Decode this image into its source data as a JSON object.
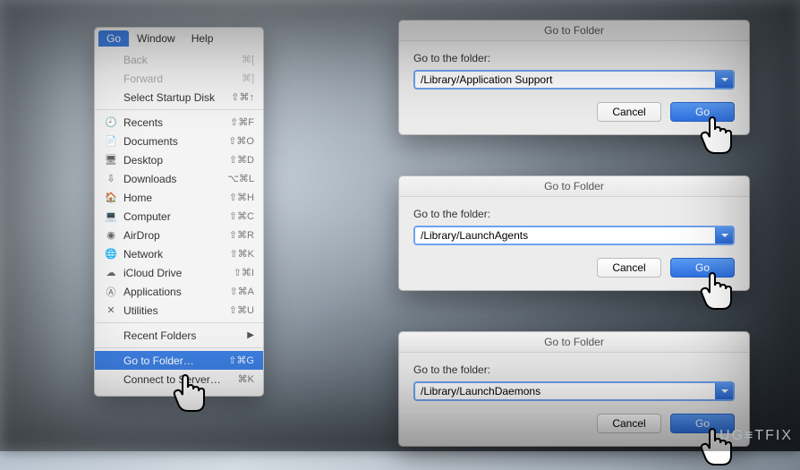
{
  "watermark": "UG≡TFIX",
  "menu": {
    "tabs": [
      "Go",
      "Window",
      "Help"
    ],
    "active_tab": "Go",
    "items_block1": [
      {
        "label": "Back",
        "shortcut": "⌘[",
        "disabled": true
      },
      {
        "label": "Forward",
        "shortcut": "⌘]",
        "disabled": true
      },
      {
        "label": "Select Startup Disk",
        "shortcut": "⇧⌘↑",
        "disabled": false
      }
    ],
    "items_block2": [
      {
        "icon": "recents-icon",
        "glyph": "🕘",
        "label": "Recents",
        "shortcut": "⇧⌘F"
      },
      {
        "icon": "documents-icon",
        "glyph": "📄",
        "label": "Documents",
        "shortcut": "⇧⌘O"
      },
      {
        "icon": "desktop-icon",
        "glyph": "🖥",
        "label": "Desktop",
        "shortcut": "⇧⌘D"
      },
      {
        "icon": "downloads-icon",
        "glyph": "⇩",
        "label": "Downloads",
        "shortcut": "⌥⌘L"
      },
      {
        "icon": "home-icon",
        "glyph": "🏠",
        "label": "Home",
        "shortcut": "⇧⌘H"
      },
      {
        "icon": "computer-icon",
        "glyph": "💻",
        "label": "Computer",
        "shortcut": "⇧⌘C"
      },
      {
        "icon": "airdrop-icon",
        "glyph": "◉",
        "label": "AirDrop",
        "shortcut": "⇧⌘R"
      },
      {
        "icon": "network-icon",
        "glyph": "🌐",
        "label": "Network",
        "shortcut": "⇧⌘K"
      },
      {
        "icon": "icloud-icon",
        "glyph": "☁",
        "label": "iCloud Drive",
        "shortcut": "⇧⌘I"
      },
      {
        "icon": "applications-icon",
        "glyph": "Ⓐ",
        "label": "Applications",
        "shortcut": "⇧⌘A"
      },
      {
        "icon": "utilities-icon",
        "glyph": "✕",
        "label": "Utilities",
        "shortcut": "⇧⌘U"
      }
    ],
    "recent_folders": {
      "label": "Recent Folders"
    },
    "items_block3": [
      {
        "label": "Go to Folder…",
        "shortcut": "⇧⌘G",
        "highlight": true
      },
      {
        "label": "Connect to Server…",
        "shortcut": "⌘K"
      }
    ]
  },
  "dialogs": [
    {
      "title": "Go to Folder",
      "label": "Go to the folder:",
      "value": "/Library/Application Support",
      "cancel": "Cancel",
      "go": "Go"
    },
    {
      "title": "Go to Folder",
      "label": "Go to the folder:",
      "value": "/Library/LaunchAgents",
      "cancel": "Cancel",
      "go": "Go"
    },
    {
      "title": "Go to Folder",
      "label": "Go to the folder:",
      "value": "/Library/LaunchDaemons",
      "cancel": "Cancel",
      "go": "Go"
    }
  ]
}
